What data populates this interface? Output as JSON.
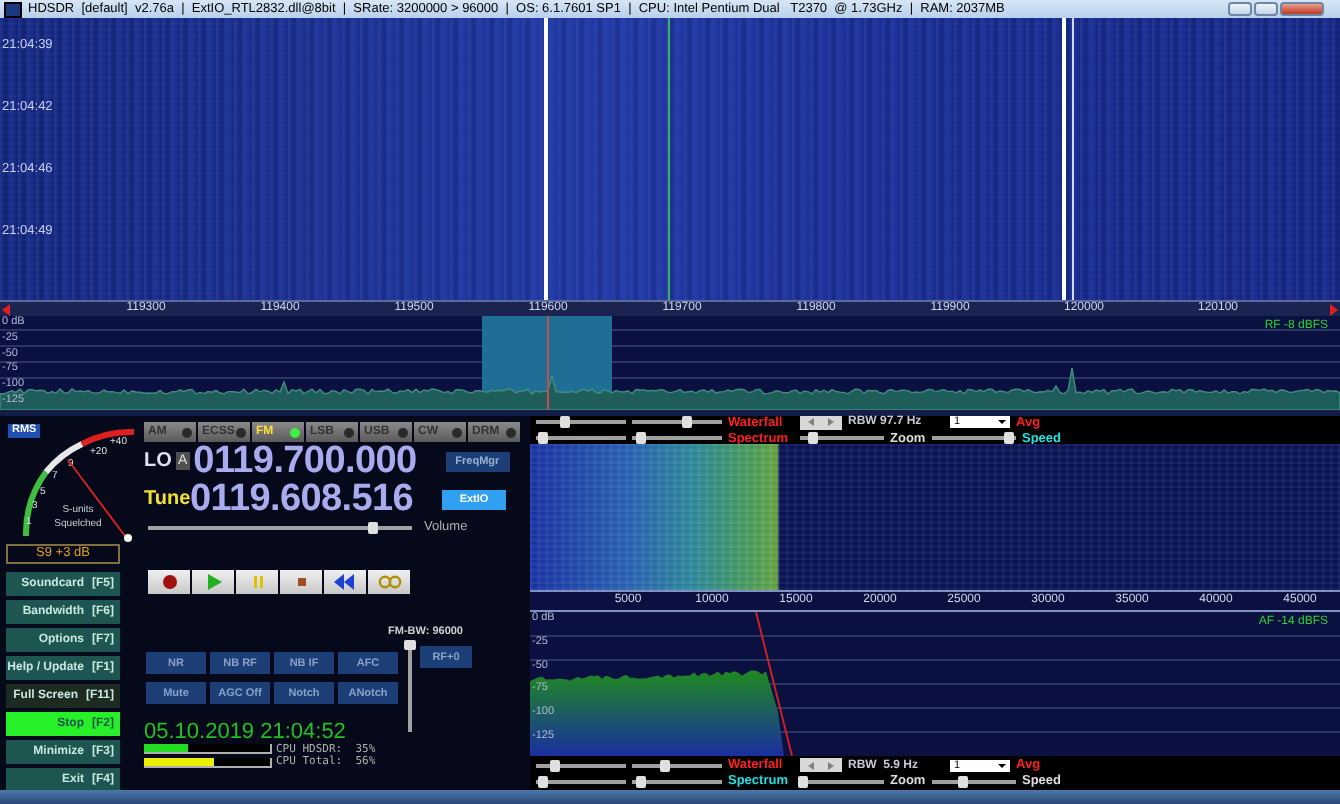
{
  "window": {
    "title": "HDSDR  [default]  v2.76a  |  ExtIO_RTL2832.dll@8bit  |  SRate: 3200000 > 96000  |  OS: 6.1.7601 SP1  |  CPU: Intel Pentium Dual   T2370  @ 1.73GHz  |  RAM: 2037MB"
  },
  "rf_waterfall": {
    "time_labels": [
      "21:04:39",
      "21:04:42",
      "21:04:46",
      "21:04:49"
    ]
  },
  "rf_axis": {
    "labels": [
      "119300",
      "119400",
      "119500",
      "119600",
      "119700",
      "119800",
      "119900",
      "120000",
      "120100"
    ]
  },
  "rf_spectrum": {
    "db_labels": [
      "0 dB",
      "-25",
      "-50",
      "-75",
      "-100",
      "-125"
    ],
    "reading": "RF -8 dBFS"
  },
  "s_meter": {
    "mode": "RMS",
    "scale": [
      "1",
      "3",
      "5",
      "7",
      "9",
      "+20",
      "+40"
    ],
    "caption": [
      "S-units",
      "Squelched"
    ],
    "reading": "S9 +3 dB"
  },
  "modes": [
    {
      "label": "AM",
      "selected": false
    },
    {
      "label": "ECSS",
      "selected": false
    },
    {
      "label": "FM",
      "selected": true
    },
    {
      "label": "LSB",
      "selected": false
    },
    {
      "label": "USB",
      "selected": false
    },
    {
      "label": "CW",
      "selected": false
    },
    {
      "label": "DRM",
      "selected": false
    }
  ],
  "lo": {
    "label": "LO",
    "vfo": "A",
    "frequency": "0119.700.000",
    "button": "FreqMgr"
  },
  "tune": {
    "label": "Tune",
    "frequency": "0119.608.516",
    "button": "ExtIO"
  },
  "volume": {
    "label": "Volume",
    "level": 0.85
  },
  "function_buttons": [
    {
      "label": "Soundcard",
      "key": "[F5]",
      "kind": "normal"
    },
    {
      "label": "Bandwidth",
      "key": "[F6]",
      "kind": "normal"
    },
    {
      "label": "Options",
      "key": "[F7]",
      "kind": "normal"
    },
    {
      "label": "Help / Update",
      "key": "[F1]",
      "kind": "normal"
    },
    {
      "label": "Full Screen",
      "key": "[F11]",
      "kind": "dim"
    },
    {
      "label": "Stop",
      "key": "[F2]",
      "kind": "active"
    },
    {
      "label": "Minimize",
      "key": "[F3]",
      "kind": "normal"
    },
    {
      "label": "Exit",
      "key": "[F4]",
      "kind": "normal"
    }
  ],
  "fm_bandwidth": {
    "label": "FM-BW: 96000",
    "level": 0.95
  },
  "dsp_buttons": [
    {
      "label": "NR"
    },
    {
      "label": "NB RF"
    },
    {
      "label": "NB IF"
    },
    {
      "label": "AFC"
    },
    {
      "label": "Mute"
    },
    {
      "label": "AGC Off"
    },
    {
      "label": "Notch"
    },
    {
      "label": "ANotch"
    }
  ],
  "rf_gain_button": "RF+0",
  "clock": "05.10.2019 21:04:52",
  "cpu": [
    {
      "label": "CPU HDSDR:  35%",
      "level": 0.35,
      "color": "#22dd22"
    },
    {
      "label": "CPU Total:  56%",
      "level": 0.56,
      "color": "#eeee00"
    }
  ],
  "af_top_controls": {
    "sliders": [
      {
        "level": 0.3
      },
      {
        "level": 0.6
      },
      {
        "level": 0.07
      },
      {
        "level": 0.09
      },
      {
        "level": 0.15
      },
      {
        "level": 0.9
      }
    ],
    "rbw": "RBW 97.7 Hz",
    "average": "1",
    "labels": [
      {
        "kind": "waterfall",
        "text": "Waterfall",
        "color": "#ff2020"
      },
      {
        "kind": "avg",
        "text": "Avg",
        "color": "#ff2020"
      },
      {
        "kind": "spectrum",
        "text": "Spectrum",
        "color": "#ff2020"
      },
      {
        "kind": "zoom",
        "text": "Zoom",
        "color": "#dddddd"
      },
      {
        "kind": "speed",
        "text": "Speed",
        "color": "#20e0e0"
      }
    ]
  },
  "af_axis": {
    "labels": [
      "5000",
      "10000",
      "15000",
      "20000",
      "25000",
      "30000",
      "35000",
      "40000",
      "45000"
    ]
  },
  "af_spectrum": {
    "db_labels": [
      "0 dB",
      "-25",
      "-50",
      "-75",
      "-100",
      "-125"
    ],
    "reading": "AF -14 dBFS"
  },
  "af_bottom_controls": {
    "sliders": [
      {
        "level": 0.2
      },
      {
        "level": 0.35
      },
      {
        "level": 0.07
      },
      {
        "level": 0.09
      },
      {
        "level": 0.02
      },
      {
        "level": 0.35
      }
    ],
    "rbw": "RBW  5.9 Hz",
    "average": "1",
    "labels": [
      {
        "kind": "waterfall",
        "text": "Waterfall",
        "color": "#ff2020"
      },
      {
        "kind": "avg",
        "text": "Avg",
        "color": "#ff2020"
      },
      {
        "kind": "spectrum",
        "text": "Spectrum",
        "color": "#20e0e0"
      },
      {
        "kind": "zoom",
        "text": "Zoom",
        "color": "#dddddd"
      },
      {
        "kind": "speed",
        "text": "Speed",
        "color": "#dddddd"
      }
    ]
  }
}
